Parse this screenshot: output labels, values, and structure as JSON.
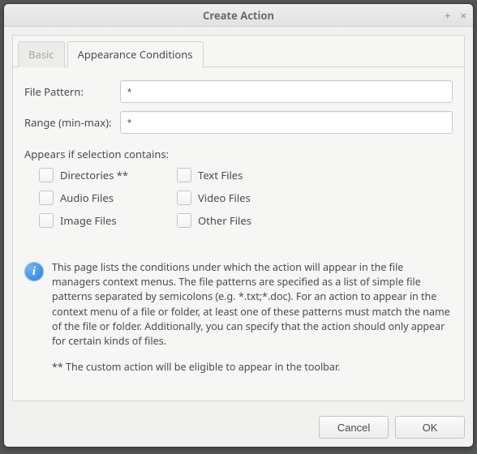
{
  "window": {
    "title": "Create Action"
  },
  "tabs": {
    "basic": "Basic",
    "appearance": "Appearance Conditions"
  },
  "fields": {
    "file_pattern": {
      "label": "File Pattern:",
      "value": "*"
    },
    "range": {
      "label": "Range (min-max):",
      "value": "*"
    }
  },
  "contains": {
    "label": "Appears if selection contains:",
    "items": [
      {
        "label": "Directories **",
        "checked": false
      },
      {
        "label": "Text Files",
        "checked": false
      },
      {
        "label": "Audio Files",
        "checked": false
      },
      {
        "label": "Video Files",
        "checked": false
      },
      {
        "label": "Image Files",
        "checked": false
      },
      {
        "label": "Other Files",
        "checked": false
      }
    ]
  },
  "info": {
    "paragraph": "This page lists the conditions under which the action will appear in the file managers context menus. The file patterns are specified as a list of simple file patterns separated by semicolons (e.g. *.txt;*.doc). For an action to appear in the context menu of a file or folder, at least one of these patterns must match the name of the file or folder. Additionally, you can specify that the action should only appear for certain kinds of files.",
    "footnote": "** The custom action will be eligible to appear in the toolbar."
  },
  "footer": {
    "cancel": "Cancel",
    "ok": "OK"
  }
}
